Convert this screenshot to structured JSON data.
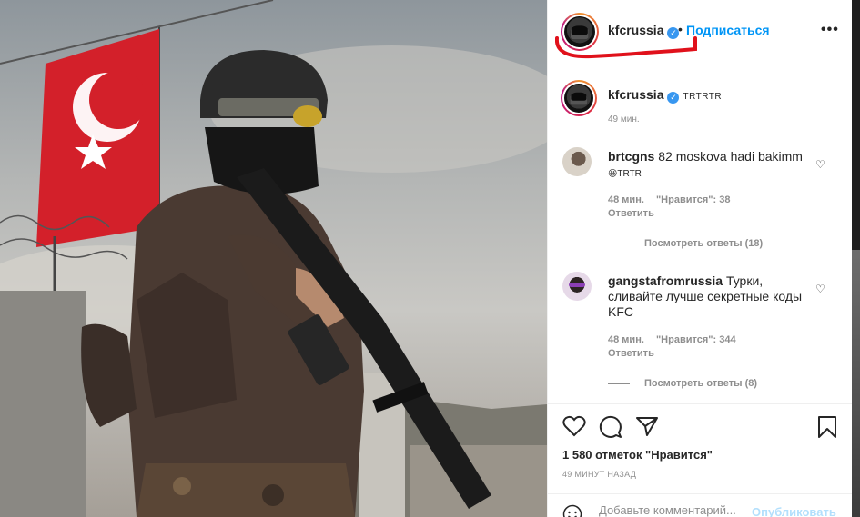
{
  "post": {
    "username": "kfcrussia",
    "verified_icon": "verified-badge-icon",
    "dot": "•",
    "follow_label": "Подписаться",
    "more_label": "•••"
  },
  "caption": {
    "username": "kfcrussia",
    "text": "TRTRTR",
    "time": "49 мин."
  },
  "comments": [
    {
      "username": "brtcgns",
      "text": "82 moskova hadi bakimm",
      "text_suffix": "😆TRTR",
      "time": "48 мин.",
      "likes": "\"Нравится\": 38",
      "reply_label": "Ответить",
      "view_replies": "Посмотреть ответы (18)"
    },
    {
      "username": "gangstafromrussia",
      "text": "Турки, сливайте лучше секретные коды KFC",
      "time": "48 мин.",
      "likes": "\"Нравится\": 344",
      "reply_label": "Ответить",
      "view_replies": "Посмотреть ответы (8)"
    }
  ],
  "actions": {
    "likes_count": "1 580 отметок \"Нравится\"",
    "time_ago": "49 МИНУТ НАЗАД"
  },
  "add_comment": {
    "placeholder": "Добавьте комментарий...",
    "post_label": "Опубликовать"
  },
  "colors": {
    "accent": "#0095f6",
    "annotation_red": "#e0111b",
    "flag_red": "#d3202a"
  }
}
